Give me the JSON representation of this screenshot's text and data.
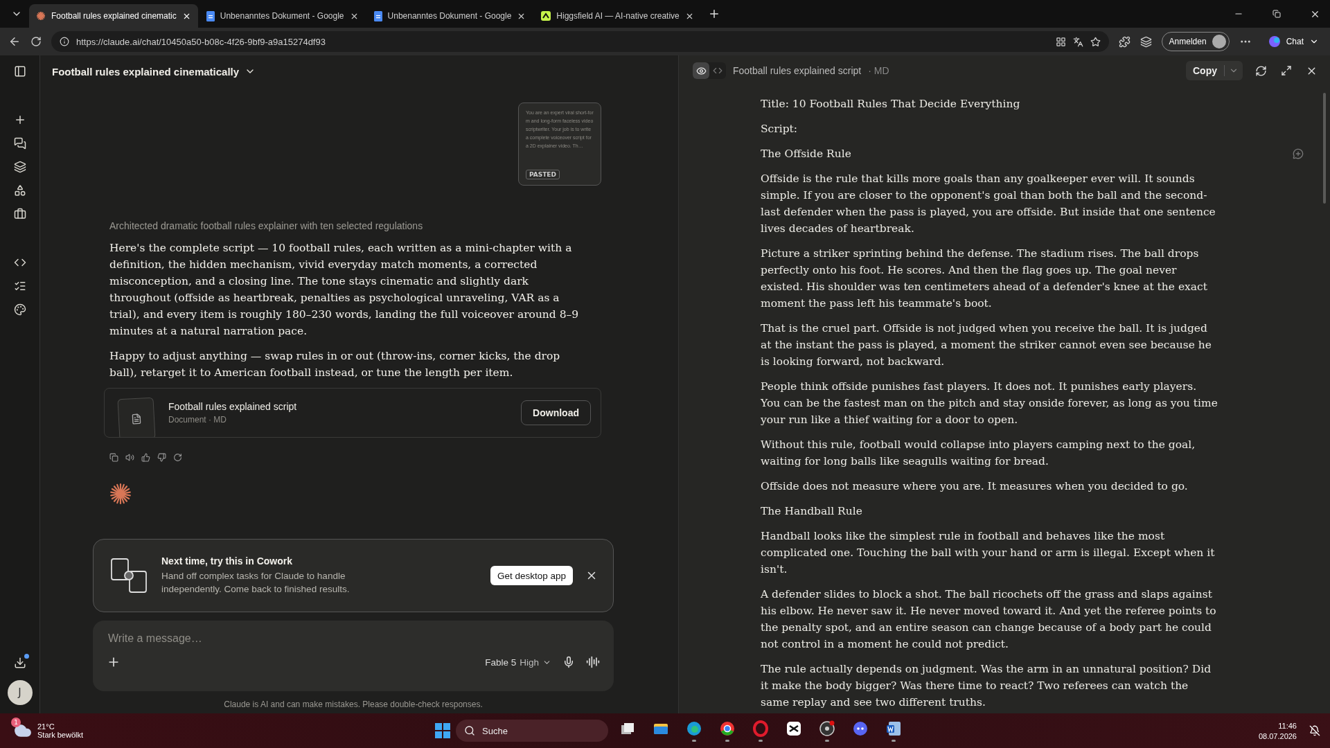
{
  "browser": {
    "tabs": [
      {
        "title": "Football rules explained cinematic",
        "kind": "claude",
        "selected": true
      },
      {
        "title": "Unbenanntes Dokument - Google",
        "kind": "docs",
        "selected": false
      },
      {
        "title": "Unbenanntes Dokument - Google",
        "kind": "docs",
        "selected": false
      },
      {
        "title": "Higgsfield AI — AI-native creative",
        "kind": "higgsfield",
        "selected": false
      }
    ],
    "url": "https://claude.ai/chat/10450a50-b08c-4f26-9bf9-a9a15274df93",
    "profile_label": "Anmelden",
    "chat_label": "Chat"
  },
  "sidebar": {
    "avatar_letter": "J"
  },
  "chat": {
    "title": "Football rules explained cinematically",
    "pasted": {
      "preview": "You are an expert viral short-form and long-form faceless video scriptwriter. Your job is to write a complete voiceover script for a 2D explainer video. Th…",
      "badge": "PASTED"
    },
    "thinking_summary": "Architected dramatic football rules explainer with ten selected regulations",
    "paragraphs": [
      "Here's the complete script — 10 football rules, each written as a mini-chapter with a definition, the hidden mechanism, vivid everyday match moments, a corrected misconception, and a closing line. The tone stays cinematic and slightly dark throughout (offside as heartbreak, penalties as psychological unraveling, VAR as a trial), and every item is roughly 180–230 words, landing the full voiceover around 8–9 minutes at a natural narration pace.",
      "Happy to adjust anything — swap rules in or out (throw-ins, corner kicks, the drop ball), retarget it to American football instead, or tune the length per item."
    ],
    "artifact": {
      "title": "Football rules explained script",
      "meta": "Document · MD",
      "button": "Download"
    },
    "cowork": {
      "title": "Next time, try this in Cowork",
      "body": "Hand off complex tasks for Claude to handle independently. Come back to finished results.",
      "button": "Get desktop app"
    },
    "composer": {
      "placeholder": "Write a message…",
      "model": "Fable 5",
      "effort": "High"
    },
    "disclaimer": "Claude is AI and can make mistakes. Please double-check responses."
  },
  "artifact_panel": {
    "view_modes": [
      {
        "kind": "preview",
        "selected": true
      },
      {
        "kind": "code",
        "selected": false
      }
    ],
    "title": "Football rules explained script",
    "format": "· MD",
    "copy_label": "Copy",
    "blocks": [
      {
        "text": "Title: 10 Football Rules That Decide Everything",
        "comment_icon": false
      },
      {
        "text": "Script:",
        "comment_icon": false
      },
      {
        "text": "The Offside Rule",
        "comment_icon": true
      },
      {
        "text": "Offside is the rule that kills more goals than any goalkeeper ever will. It sounds simple. If you are closer to the opponent's goal than both the ball and the second-last defender when the pass is played, you are offside. But inside that one sentence lives decades of heartbreak.",
        "comment_icon": false
      },
      {
        "text": "Picture a striker sprinting behind the defense. The stadium rises. The ball drops perfectly onto his foot. He scores. And then the flag goes up. The goal never existed. His shoulder was ten centimeters ahead of a defender's knee at the exact moment the pass left his teammate's boot.",
        "comment_icon": false
      },
      {
        "text": "That is the cruel part. Offside is not judged when you receive the ball. It is judged at the instant the pass is played, a moment the striker cannot even see because he is looking forward, not backward.",
        "comment_icon": false
      },
      {
        "text": "People think offside punishes fast players. It does not. It punishes early players. You can be the fastest man on the pitch and stay onside forever, as long as you time your run like a thief waiting for a door to open.",
        "comment_icon": false
      },
      {
        "text": "Without this rule, football would collapse into players camping next to the goal, waiting for long balls like seagulls waiting for bread.",
        "comment_icon": false
      },
      {
        "text": "Offside does not measure where you are. It measures when you decided to go.",
        "comment_icon": false
      },
      {
        "text": "The Handball Rule",
        "comment_icon": false
      },
      {
        "text": "Handball looks like the simplest rule in football and behaves like the most complicated one. Touching the ball with your hand or arm is illegal. Except when it isn't.",
        "comment_icon": false
      },
      {
        "text": "A defender slides to block a shot. The ball ricochets off the grass and slaps against his elbow. He never saw it. He never moved toward it. And yet the referee points to the penalty spot, and an entire season can change because of a body part he could not control in a moment he could not predict.",
        "comment_icon": false
      },
      {
        "text": "The rule actually depends on judgment. Was the arm in an unnatural position? Did it make the body bigger? Was there time to react? Two referees can watch the same replay and see two different truths.",
        "comment_icon": false
      }
    ]
  },
  "taskbar": {
    "weather": {
      "badge": "1",
      "temperature": "21°C",
      "condition": "Stark bewölkt"
    },
    "search_placeholder": "Suche",
    "apps": [
      {
        "kind": "taskview",
        "running": false
      },
      {
        "kind": "files",
        "running": false
      },
      {
        "kind": "edge",
        "running": true
      },
      {
        "kind": "chrome",
        "running": true
      },
      {
        "kind": "opera",
        "running": true
      },
      {
        "kind": "capcut",
        "running": false
      },
      {
        "kind": "obs",
        "running": true
      },
      {
        "kind": "discord",
        "running": false
      },
      {
        "kind": "word",
        "running": true
      }
    ],
    "time": "11:46",
    "date": "08.07.2026"
  }
}
